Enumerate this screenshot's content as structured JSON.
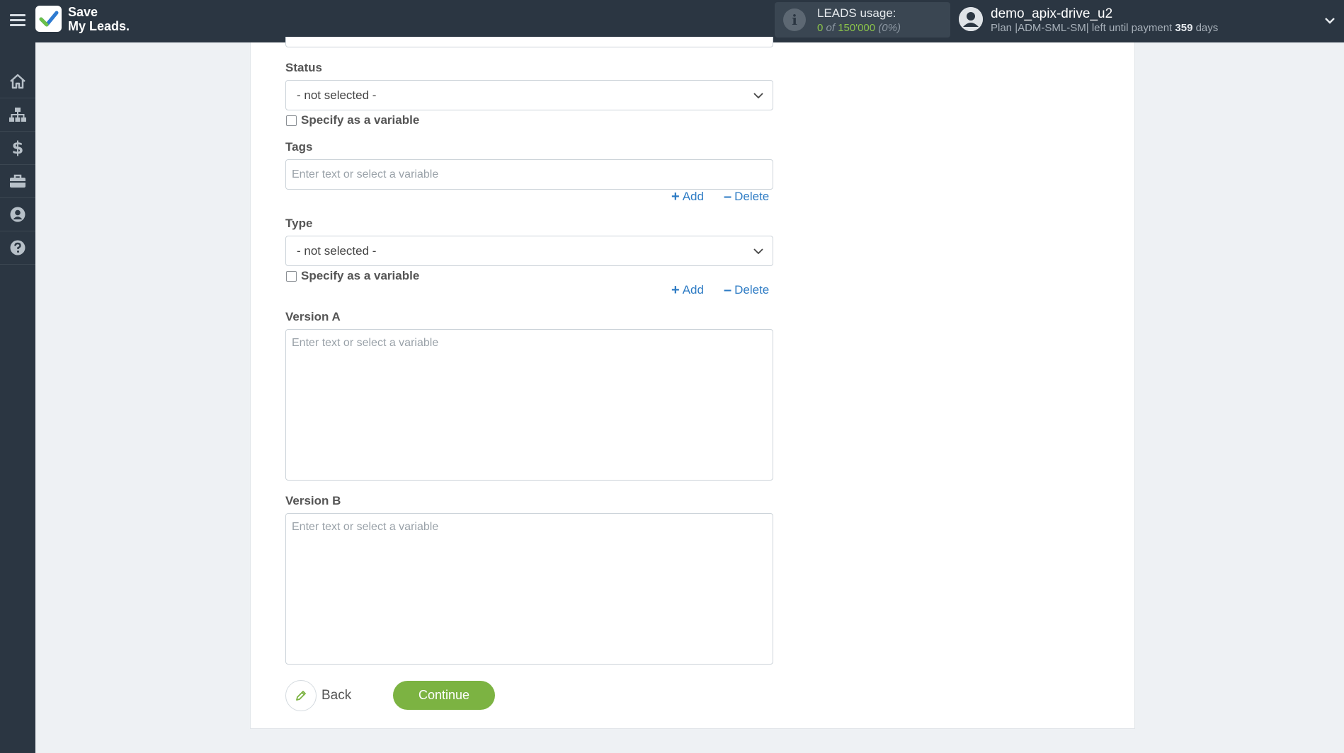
{
  "app": {
    "logo_line1": "Save",
    "logo_line2": "My Leads."
  },
  "usage": {
    "label": "LEADS usage:",
    "used": "0",
    "of_text": "of",
    "total": "150'000",
    "percent": "(0%)"
  },
  "user": {
    "name": "demo_apix-drive_u2",
    "plan_prefix": "Plan |ADM-SML-SM| left until payment",
    "days_left": "359",
    "days_suffix": "days"
  },
  "sidebar": {
    "items": [
      {
        "icon": "home-icon"
      },
      {
        "icon": "sitemap-icon"
      },
      {
        "icon": "dollar-icon"
      },
      {
        "icon": "briefcase-icon"
      },
      {
        "icon": "user-icon"
      },
      {
        "icon": "help-icon"
      }
    ]
  },
  "form": {
    "status": {
      "label": "Status",
      "value": "- not selected -",
      "checkbox_label": "Specify as a variable"
    },
    "tags": {
      "label": "Tags",
      "placeholder": "Enter text or select a variable",
      "add_label": "Add",
      "delete_label": "Delete"
    },
    "type": {
      "label": "Type",
      "value": "- not selected -",
      "checkbox_label": "Specify as a variable",
      "add_label": "Add",
      "delete_label": "Delete"
    },
    "version_a": {
      "label": "Version A",
      "placeholder": "Enter text or select a variable"
    },
    "version_b": {
      "label": "Version B",
      "placeholder": "Enter text or select a variable"
    }
  },
  "buttons": {
    "back_label": "Back",
    "continue_label": "Continue"
  },
  "colors": {
    "topbar": "#2b3642",
    "accent_green": "#7cb342",
    "link_blue": "#2d7bc4"
  }
}
